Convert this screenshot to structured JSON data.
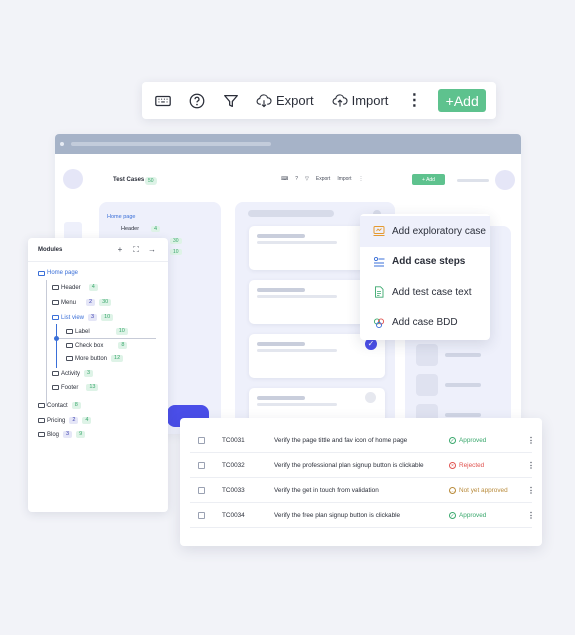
{
  "toolbar": {
    "export_label": "Export",
    "import_label": "Import",
    "add_label": "+Add"
  },
  "window": {
    "title": "Test Cases",
    "count": "50",
    "export_label": "Export",
    "import_label": "Import",
    "add_label": "+ Add",
    "tree_home": "Home page",
    "tree_header": "Header",
    "tree_header_count": "4",
    "green_badge_1": "30",
    "green_badge_2": "10"
  },
  "dropdown": {
    "items": [
      {
        "label": "Add exploratory case",
        "icon": "exploratory-icon"
      },
      {
        "label": "Add case steps",
        "icon": "steps-icon"
      },
      {
        "label": "Add test case text",
        "icon": "text-document-icon"
      },
      {
        "label": "Add case BDD",
        "icon": "bdd-icon"
      }
    ]
  },
  "modules": {
    "title": "Modules",
    "tree": {
      "home": "Home page",
      "header": {
        "label": "Header",
        "green": "4"
      },
      "menu": {
        "label": "Menu",
        "blue": "2",
        "green": "30"
      },
      "list_view": {
        "label": "List view",
        "blue": "3",
        "green": "10"
      },
      "label": {
        "label": "Label",
        "green": "10"
      },
      "check_box": {
        "label": "Check box",
        "green": "8"
      },
      "more_button": {
        "label": "More button",
        "green": "12"
      },
      "activity": {
        "label": "Activity",
        "green": "3"
      },
      "footer": {
        "label": "Footer",
        "green": "13"
      },
      "contact": {
        "label": "Contact",
        "green": "8"
      },
      "pricing": {
        "label": "Pricing",
        "blue": "2",
        "green": "4"
      },
      "blog": {
        "label": "Blog",
        "blue": "3",
        "green": "9"
      }
    }
  },
  "table": {
    "rows": [
      {
        "id": "TC0031",
        "desc": "Verify the page tittle and fav icon of home page",
        "status": "Approved",
        "status_color": "#3aa86d"
      },
      {
        "id": "TC0032",
        "desc": "Verify the professional plan signup button is clickable",
        "status": "Rejected",
        "status_color": "#e0524f"
      },
      {
        "id": "TC0033",
        "desc": "Verify the get in touch from validation",
        "status": "Not yet approved",
        "status_color": "#b98b3b"
      },
      {
        "id": "TC0034",
        "desc": "Verify the free plan signup button is clickable",
        "status": "Approved",
        "status_color": "#3aa86d"
      }
    ]
  }
}
